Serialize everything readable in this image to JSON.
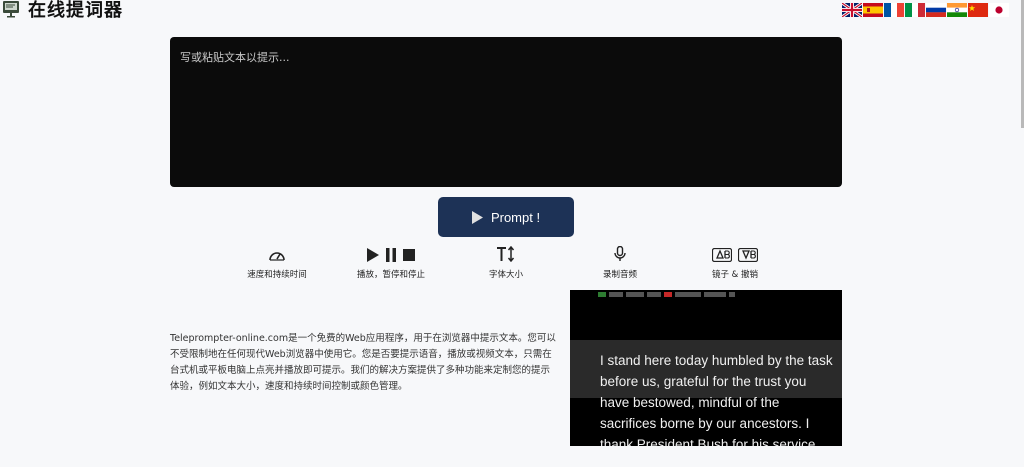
{
  "header": {
    "title": "在线提词器",
    "logo_icon": "teleprompter-logo-icon",
    "flags": [
      {
        "name": "uk-flag-icon"
      },
      {
        "name": "spain-flag-icon"
      },
      {
        "name": "france-flag-icon"
      },
      {
        "name": "italy-flag-icon"
      },
      {
        "name": "russia-flag-icon"
      },
      {
        "name": "india-flag-icon"
      },
      {
        "name": "china-flag-icon"
      },
      {
        "name": "japan-flag-icon"
      }
    ]
  },
  "editor": {
    "placeholder": "写或粘贴文本以提示..."
  },
  "prompt_button": {
    "label": "Prompt !",
    "color": "#1d3256"
  },
  "features": [
    {
      "icon": "speedometer-icon",
      "label": "速度和持续时间"
    },
    {
      "icon": "play-pause-stop-icons",
      "label": "播放，暂停和停止"
    },
    {
      "icon": "text-size-icon",
      "label": "字体大小"
    },
    {
      "icon": "microphone-icon",
      "label": "录制音频"
    },
    {
      "icon": "mirror-icons",
      "label": "镜子 & 撤销"
    }
  ],
  "description": "Teleprompter-online.com是一个免费的Web应用程序，用于在浏览器中提示文本。您可以不受限制地在任何现代Web浏览器中使用它。您是否要提示语音，播放或视频文本，只需在台式机或平板电脑上点亮并播放即可提示。我们的解决方案提供了多种功能来定制您的提示体验，例如文本大小，速度和持续时间控制或颜色管理。",
  "demo": {
    "text": "I stand here today humbled by the task before us, grateful for the trust you have bestowed, mindful of the sacrifices borne by our ancestors. I thank President Bush for his service"
  }
}
